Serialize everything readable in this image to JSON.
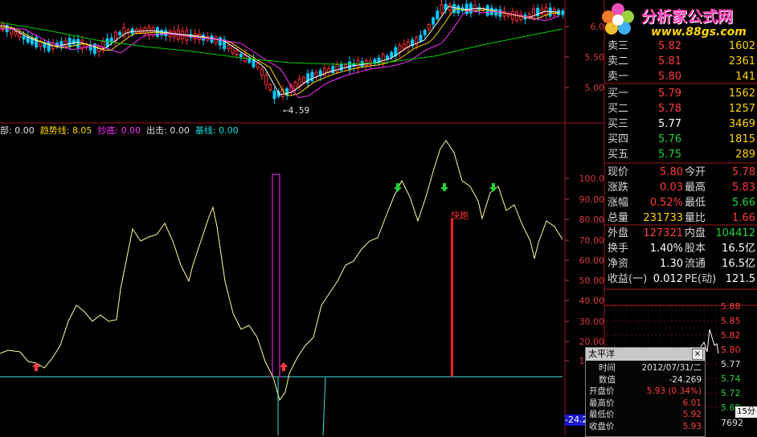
{
  "watermark": {
    "site_name": "分析家公式网",
    "url": "www.88gs.com"
  },
  "price_chart": {
    "axis_labels": [
      "6.0",
      "5.50",
      "5.00"
    ],
    "low_marker": "4.59",
    "colors": {
      "candle_up": "#ff3030",
      "candle_down": "#00c8ff",
      "ma5": "#ffffff",
      "ma10": "#ffd400",
      "ma20": "#ff30ff",
      "ma60": "#00d000"
    }
  },
  "indicator_legend": [
    {
      "name": "部:",
      "value": "0.00",
      "color": "#e0e0e0"
    },
    {
      "name": "趋势线:",
      "value": "8.05",
      "color": "#ffd400"
    },
    {
      "name": "抄底:",
      "value": "0.00",
      "color": "#ff30ff"
    },
    {
      "name": "出击:",
      "value": "0.00",
      "color": "#e0e0e0"
    },
    {
      "name": "基线:",
      "value": "0.00",
      "color": "#00e0e0"
    }
  ],
  "indicator_chart": {
    "axis_labels": [
      "100.0",
      "90.00",
      "80.00",
      "70.00",
      "60.00",
      "50.00",
      "40.00",
      "30.00",
      "20.00",
      "10.00",
      "1"
    ],
    "run_label": "快跑",
    "current_value": "-24.2",
    "colors": {
      "trend": "#ffff99",
      "bottom_fish": "#ff30ff",
      "baseline": "#40e0e0",
      "run_signal": "#ff2020",
      "buy_arrow": "#ff3b3b",
      "sell_arrow": "#22d13a"
    }
  },
  "quote_panel": {
    "asks": [
      {
        "label": "卖三",
        "price": "5.82",
        "volume": "1602"
      },
      {
        "label": "卖二",
        "price": "5.81",
        "volume": "2361"
      },
      {
        "label": "卖一",
        "price": "5.80",
        "volume": "141"
      }
    ],
    "bids": [
      {
        "label": "买一",
        "price": "5.79",
        "volume": "1562"
      },
      {
        "label": "买二",
        "price": "5.78",
        "volume": "1257"
      },
      {
        "label": "买三",
        "price": "5.77",
        "volume": "3469"
      },
      {
        "label": "买四",
        "price": "5.76",
        "volume": "1815"
      },
      {
        "label": "买五",
        "price": "5.75",
        "volume": "289"
      }
    ],
    "stats": [
      {
        "l1": "现价",
        "v1": "5.80",
        "c1": "red",
        "l2": "今开",
        "v2": "5.78",
        "c2": "red"
      },
      {
        "l1": "涨跌",
        "v1": "0.03",
        "c1": "red",
        "l2": "最高",
        "v2": "5.83",
        "c2": "red"
      },
      {
        "l1": "涨幅",
        "v1": "0.52%",
        "c1": "red",
        "l2": "最低",
        "v2": "5.66",
        "c2": "grn"
      },
      {
        "l1": "总量",
        "v1": "231733",
        "c1": "yel",
        "l2": "量比",
        "v2": "1.66",
        "c2": "red"
      },
      {
        "l1": "外盘",
        "v1": "127321",
        "c1": "red",
        "l2": "内盘",
        "v2": "104412",
        "c2": "grn"
      },
      {
        "l1": "换手",
        "v1": "1.40%",
        "c1": "wht",
        "l2": "股本",
        "v2": "16.5亿",
        "c2": "wht"
      },
      {
        "l1": "净资",
        "v1": "1.30",
        "c1": "wht",
        "l2": "流通",
        "v2": "16.5亿",
        "c2": "wht"
      },
      {
        "l1": "收益(一)",
        "v1": "0.012",
        "c1": "wht",
        "l2": "PE(动)",
        "v2": "121.5",
        "c2": "wht"
      }
    ]
  },
  "mini_chart": {
    "price_labels": [
      "5.88",
      "5.85",
      "5.82",
      "5.80",
      "5.77",
      "5.74",
      "5.72",
      "5.69"
    ],
    "volume_label": "7692",
    "period_label": "15分"
  },
  "tooltip": {
    "title": "太平洋",
    "close_glyph": "×",
    "rows": [
      {
        "key": "时间",
        "value": "2012/07/31/二",
        "color": "#e0e0e0"
      },
      {
        "key": "数值",
        "value": "-24.269",
        "color": "#e0e0e0"
      },
      {
        "key": "开盘价",
        "value": "5.93 (0.34%)",
        "color": "#ff3b3b"
      },
      {
        "key": "最高价",
        "value": "6.01",
        "color": "#ff3b3b"
      },
      {
        "key": "最低价",
        "value": "5.92",
        "color": "#ff3b3b"
      },
      {
        "key": "收盘价",
        "value": "5.93",
        "color": "#ff3b3b"
      }
    ]
  }
}
